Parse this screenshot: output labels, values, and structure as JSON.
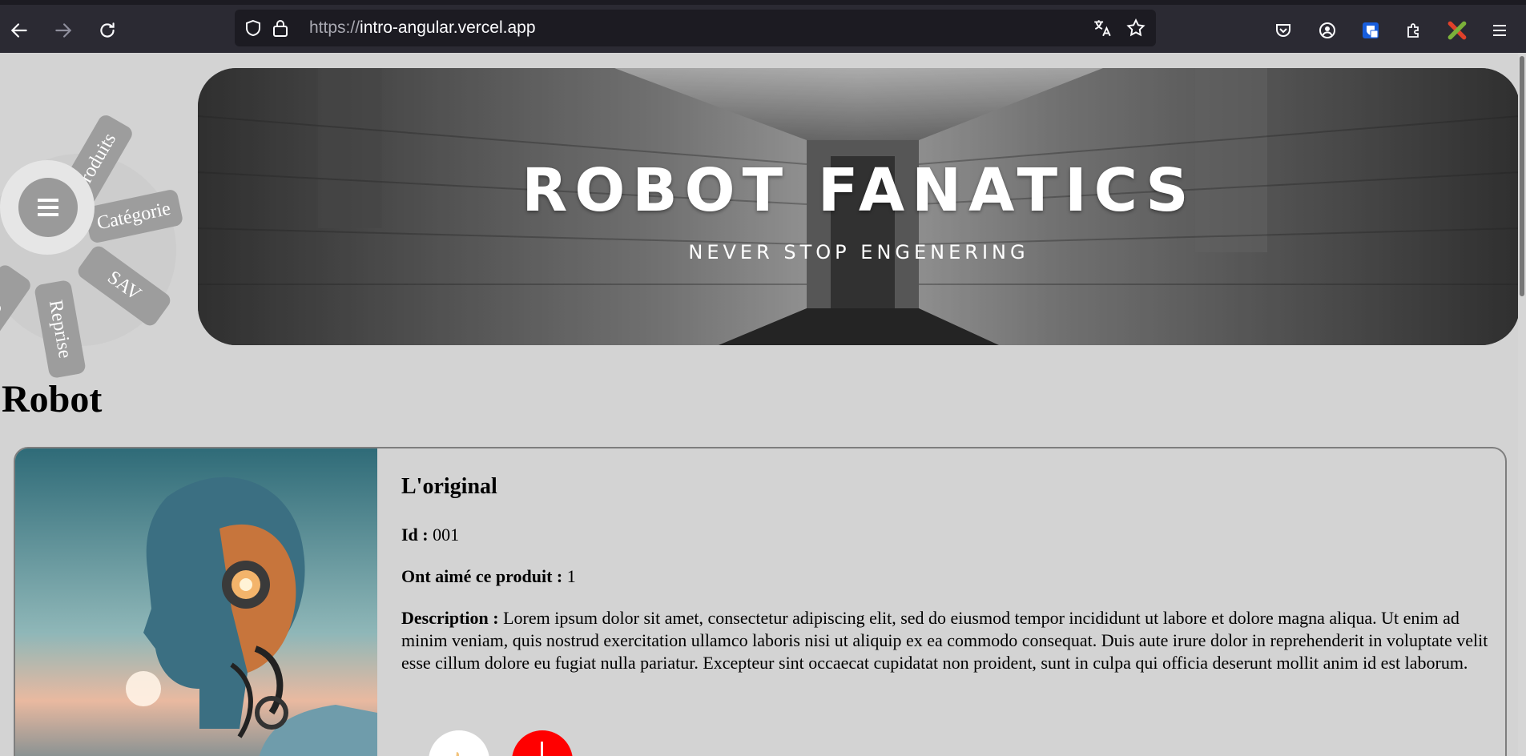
{
  "browser": {
    "url_scheme": "https://",
    "url_host": "intro-angular.vercel.app"
  },
  "menu": {
    "items": [
      "Produits",
      "Catégorie",
      "SAV",
      "Reprise",
      "Co"
    ]
  },
  "banner": {
    "title": "ROBOT FANATICS",
    "subtitle": "NEVER STOP ENGENERING"
  },
  "section": {
    "title": "Robot"
  },
  "product": {
    "name": "L'original",
    "id_label": "Id :",
    "id_value": "001",
    "likes_label": "Ont aimé ce produit :",
    "likes_value": "1",
    "desc_label": "Description :",
    "desc_value": "Lorem ipsum dolor sit amet, consectetur adipiscing elit, sed do eiusmod tempor incididunt ut labore et dolore magna aliqua. Ut enim ad minim veniam, quis nostrud exercitation ullamco laboris nisi ut aliquip ex ea commodo consequat. Duis aute irure dolor in reprehenderit in voluptate velit esse cillum dolore eu fugiat nulla pariatur. Excepteur sint occaecat cupidatat non proident, sunt in culpa qui officia deserunt mollit anim id est laborum."
  },
  "colors": {
    "page_bg": "#d3d3d3",
    "chrome_bg": "#2b2a33",
    "dislike_red": "#ff0000"
  }
}
